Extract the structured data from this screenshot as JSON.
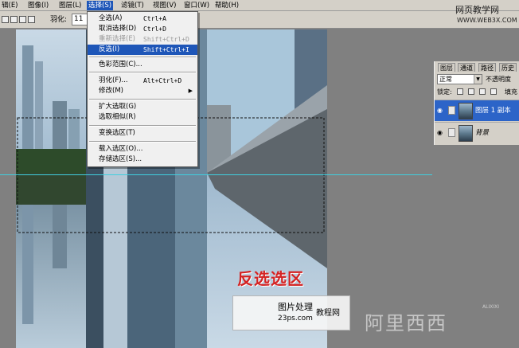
{
  "menubar": {
    "items": [
      "辑(E)",
      "图像(I)",
      "图层(L)",
      "选择(S)",
      "滤镜(T)",
      "视图(V)",
      "窗口(W)",
      "帮助(H)"
    ],
    "active_index": 3
  },
  "options": {
    "feather_label": "羽化:",
    "feather_value": "11"
  },
  "select_menu": {
    "items": [
      {
        "label": "全选(A)",
        "shortcut": "Ctrl+A",
        "state": "normal"
      },
      {
        "label": "取消选择(D)",
        "shortcut": "Ctrl+D",
        "state": "normal"
      },
      {
        "label": "重新选择(E)",
        "shortcut": "Shift+Ctrl+D",
        "state": "disabled"
      },
      {
        "label": "反选(I)",
        "shortcut": "Shift+Ctrl+I",
        "state": "highlighted"
      },
      {
        "label": "色彩范围(C)...",
        "shortcut": "",
        "state": "normal"
      },
      {
        "label": "羽化(F)...",
        "shortcut": "Alt+Ctrl+D",
        "state": "normal"
      },
      {
        "label": "修改(M)",
        "shortcut": "",
        "state": "submenu"
      },
      {
        "label": "扩大选取(G)",
        "shortcut": "",
        "state": "normal"
      },
      {
        "label": "选取相似(R)",
        "shortcut": "",
        "state": "normal"
      },
      {
        "label": "变换选区(T)",
        "shortcut": "",
        "state": "normal"
      },
      {
        "label": "载入选区(O)...",
        "shortcut": "",
        "state": "normal"
      },
      {
        "label": "存储选区(S)...",
        "shortcut": "",
        "state": "normal"
      }
    ]
  },
  "layers_panel": {
    "tabs": [
      "图层",
      "通道",
      "路径",
      "历史"
    ],
    "blend_mode": "正常",
    "opacity_label": "不透明度",
    "lock_label": "锁定:",
    "fill_label": "填充",
    "layers": [
      {
        "name": "图层 1 副本",
        "selected": true
      },
      {
        "name": "背景",
        "selected": false
      }
    ]
  },
  "watermark_top": {
    "line1": "网页教学网",
    "line2": "WWW.WEB3X.COM"
  },
  "caption": "反选选区",
  "badge": {
    "line1": "图片处理",
    "line2": "23ps.com",
    "line3": "教程网"
  },
  "watermark_bottom": "阿里西西",
  "watermark_bottom_small": "ALIXIXI",
  "colors": {
    "menu_highlight": "#1e56b8",
    "caption_red": "#d42222",
    "guide_cyan": "#3fd0e0"
  }
}
